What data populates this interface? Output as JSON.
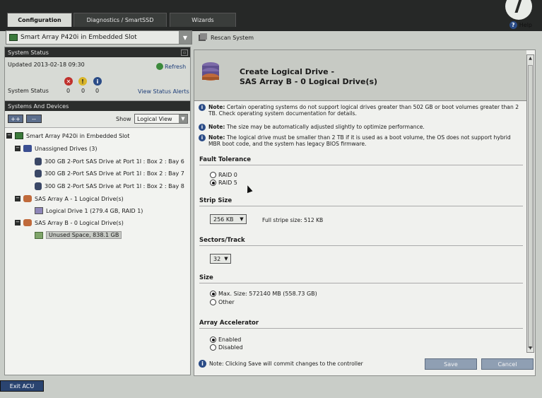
{
  "tabs": [
    {
      "label": "Configuration"
    },
    {
      "label": "Diagnostics / SmartSSD"
    },
    {
      "label": "Wizards"
    }
  ],
  "help_label": "Help",
  "controller": {
    "selected": "Smart Array P420i in Embedded Slot"
  },
  "rescan_label": "Rescan System",
  "system_status": {
    "title": "System Status",
    "updated": "Updated 2013-02-18 09:30",
    "refresh_label": "Refresh",
    "status_label": "System Status",
    "counts": {
      "critical": "0",
      "warning": "0",
      "info": "0"
    },
    "view_alerts_label": "View Status Alerts"
  },
  "systems_devices": {
    "title": "Systems And Devices",
    "expand_label": "++",
    "collapse_label": "--",
    "show_label": "Show",
    "view_selected": "Logical View",
    "tree": {
      "controller": "Smart Array P420i in Embedded Slot",
      "unassigned": "Unassigned Drives (3)",
      "drive1": "300 GB 2-Port SAS Drive at Port 1I : Box 2 : Bay 6",
      "drive2": "300 GB 2-Port SAS Drive at Port 1I : Box 2 : Bay 7",
      "drive3": "300 GB 2-Port SAS Drive at Port 1I : Box 2 : Bay 8",
      "array_a": "SAS Array A - 1 Logical Drive(s)",
      "logical_drive_1": "Logical Drive 1 (279.4 GB, RAID 1)",
      "array_b": "SAS Array B - 0 Logical Drive(s)",
      "unused": "Unused Space, 838.1 GB"
    }
  },
  "main": {
    "title_line1": "Create Logical Drive -",
    "title_line2": "SAS Array B - 0 Logical Drive(s)",
    "notes": [
      {
        "label": "Note:",
        "text": "Certain operating systems do not support logical drives greater than 502 GB or boot volumes greater than 2 TB. Check operating system documentation for details."
      },
      {
        "label": "Note:",
        "text": "The size may be automatically adjusted slightly to optimize performance."
      },
      {
        "label": "Note:",
        "text": "The logical drive must be smaller than 2 TB if it is used as a boot volume, the OS does not support hybrid MBR boot code, and the system has legacy BIOS firmware."
      }
    ],
    "fault_tolerance": {
      "title": "Fault Tolerance",
      "raid0": "RAID 0",
      "raid5": "RAID 5",
      "selected": "RAID 5"
    },
    "strip_size": {
      "title": "Strip Size",
      "value": "256 KB",
      "full_stripe": "Full stripe size: 512 KB"
    },
    "sectors_track": {
      "title": "Sectors/Track",
      "value": "32"
    },
    "size": {
      "title": "Size",
      "max": "Max. Size: 572140 MB (558.73 GB)",
      "other": "Other",
      "selected": "max"
    },
    "array_accelerator": {
      "title": "Array Accelerator",
      "enabled": "Enabled",
      "disabled": "Disabled",
      "selected": "Enabled"
    },
    "footer_note": "Note: Clicking Save will commit changes to the controller",
    "save_label": "Save",
    "cancel_label": "Cancel"
  },
  "exit_label": "Exit ACU",
  "colors": {
    "header_dark": "#262827",
    "accent_blue": "#2a4b86",
    "button": "#8f9fb3"
  }
}
